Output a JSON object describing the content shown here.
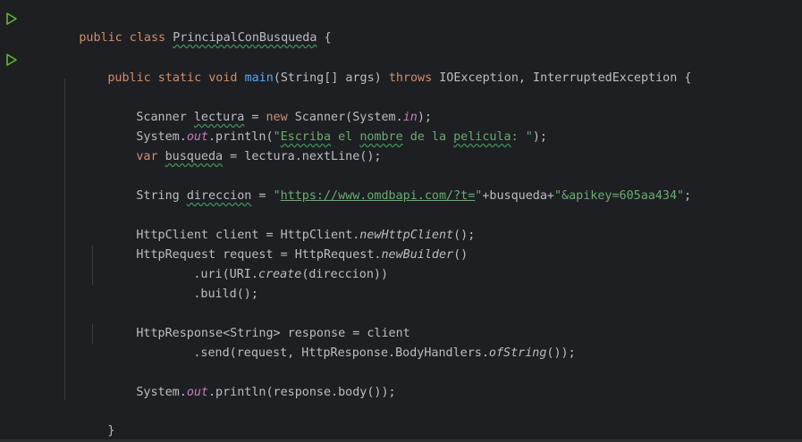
{
  "editor": {
    "lines": {
      "l1": {
        "kw": "public class ",
        "name": "PrincipalConBusqueda",
        "rest": " {"
      },
      "l2": {
        "kw": "public static void ",
        "fn": "main",
        "p1": "(String[] args) ",
        "kw2": "throws",
        "p2": " IOException, InterruptedException {"
      },
      "l3": {
        "a": "Scanner ",
        "var": "lectura",
        "b": " = ",
        "kw": "new",
        "c": " Scanner(System.",
        "fld": "in",
        "d": ");"
      },
      "l4": {
        "a": "System.",
        "fld": "out",
        "b": ".println(",
        "s1": "\"",
        "s2": "Escriba",
        "s3": " el ",
        "s4": "nombre",
        "s5": " de la ",
        "s6": "pelicula",
        "s7": ": \"",
        "c": ");"
      },
      "l5": {
        "kw": "var ",
        "var": "busqueda",
        "b": " = lectura.nextLine();"
      },
      "l6": {
        "a": "String ",
        "var": "direccion",
        "b": " = ",
        "q1": "\"",
        "url": "https://www.omdbapi.com/?t=",
        "q2": "\"",
        "c": "+busqueda+",
        "s": "\"&apikey=605aa434\"",
        "d": ";"
      },
      "l7": {
        "a": "HttpClient client = HttpClient.",
        "it": "newHttpClient",
        "b": "();"
      },
      "l8": {
        "a": "HttpRequest request = HttpRequest.",
        "it": "newBuilder",
        "b": "()"
      },
      "l9": {
        "a": ".uri(URI.",
        "it": "create",
        "b": "(direccion))"
      },
      "l10": {
        "a": ".build();"
      },
      "l11": {
        "a": "HttpResponse<String> response = client"
      },
      "l12": {
        "a": ".send(request, HttpResponse.BodyHandlers.",
        "it": "ofString",
        "b": "());"
      },
      "l13": {
        "a": "System.",
        "fld": "out",
        "b": ".println(response.body());"
      },
      "l14": {
        "a": "}"
      },
      "l15": {
        "a": "}"
      }
    }
  },
  "colors": {
    "background": "#1e1f22",
    "keyword": "#cf8e6d",
    "string": "#6aab73",
    "method": "#56a8f5",
    "field": "#c77dbb",
    "text": "#bcbec4",
    "run_icon": "#5fb832"
  },
  "icons": {
    "gutter": [
      "run-icon",
      "run-icon"
    ]
  }
}
